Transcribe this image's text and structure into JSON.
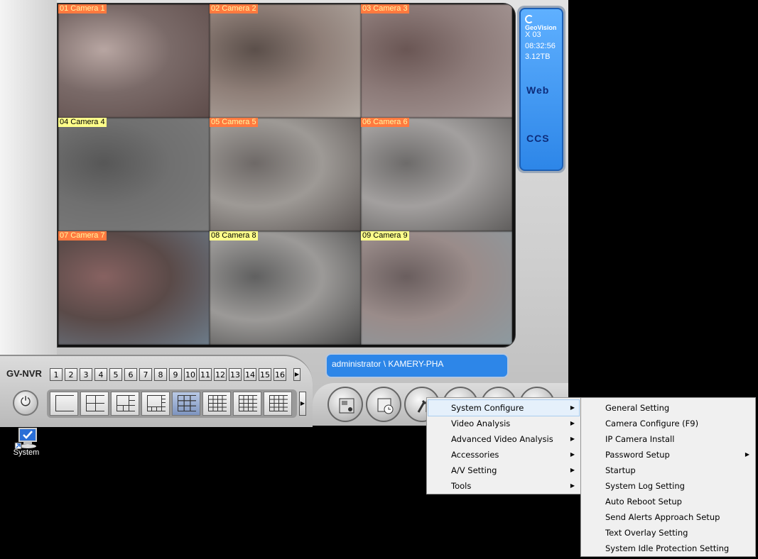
{
  "cameras": [
    {
      "label": "01 Camera 1",
      "status": "recording",
      "feed": [
        "#7a6a68",
        "#b8a6a2",
        "#5e4c4a"
      ]
    },
    {
      "label": "02 Camera 2",
      "status": "recording",
      "feed": [
        "#8f7f78",
        "#5b4f4a",
        "#b3aaa3"
      ]
    },
    {
      "label": "03 Camera 3",
      "status": "recording",
      "feed": [
        "#8c7a78",
        "#6a5654",
        "#a89a98"
      ]
    },
    {
      "label": "04 Camera 4",
      "status": "live",
      "feed": [
        "#707070",
        "#575757",
        "#7c7c7c"
      ]
    },
    {
      "label": "05 Camera 5",
      "status": "recording",
      "feed": [
        "#9e9a96",
        "#6e6967",
        "#5b5553"
      ]
    },
    {
      "label": "06 Camera 6",
      "status": "recording",
      "feed": [
        "#a3a09f",
        "#6d6b6a",
        "#5f5d5c"
      ]
    },
    {
      "label": "07 Camera 7",
      "status": "recording",
      "feed": [
        "#5a4a48",
        "#876261",
        "#6c7b89"
      ]
    },
    {
      "label": "08 Camera 8",
      "status": "live",
      "feed": [
        "#9c9a98",
        "#606060",
        "#4a4a4a"
      ]
    },
    {
      "label": "09 Camera 9",
      "status": "live",
      "feed": [
        "#9a8c8a",
        "#6a5e5e",
        "#8d9aa0"
      ]
    }
  ],
  "side_panel": {
    "brand": "GeoVision",
    "camera_count": "X 03",
    "time": "08:32:56",
    "disk": "3.12TB",
    "web_label": "Web",
    "ccs_label": "CCS"
  },
  "toolbar": {
    "product_label": "GV-NVR",
    "camera_numbers": [
      "1",
      "2",
      "3",
      "4",
      "5",
      "6",
      "7",
      "8",
      "9",
      "10",
      "11",
      "12",
      "13",
      "14",
      "15",
      "16"
    ],
    "user_info": "administrator \\ KAMERY-PHA",
    "layouts": [
      "single-view-icon",
      "quad-view-icon",
      "six-view-icon",
      "eight-view-icon",
      "nine-view-icon",
      "ten-view-icon",
      "thirteen-view-icon",
      "sixteen-view-icon"
    ],
    "active_layout": 4,
    "round_buttons": [
      "exit-monitor-icon",
      "schedule-icon",
      "configure-tools-icon",
      "search-icon",
      "network-icon",
      "pda-icon"
    ]
  },
  "desktop": {
    "system_icon_label": "System"
  },
  "context_menu": {
    "items": [
      {
        "label": "System Configure",
        "submenu": true,
        "highlighted": true
      },
      {
        "label": "Video Analysis",
        "submenu": true
      },
      {
        "label": "Advanced Video Analysis",
        "submenu": true
      },
      {
        "label": "Accessories",
        "submenu": true
      },
      {
        "label": "A/V Setting",
        "submenu": true
      },
      {
        "label": "Tools",
        "submenu": true
      }
    ]
  },
  "submenu": {
    "items": [
      {
        "label": "General Setting"
      },
      {
        "label": "Camera Configure (F9)"
      },
      {
        "label": "IP Camera Install"
      },
      {
        "label": "Password Setup",
        "submenu": true
      },
      {
        "label": "Startup"
      },
      {
        "label": "System Log Setting"
      },
      {
        "label": "Auto Reboot Setup"
      },
      {
        "label": "Send Alerts Approach Setup"
      },
      {
        "label": "Text Overlay Setting"
      },
      {
        "label": "System Idle Protection Setting"
      }
    ]
  },
  "colors": {
    "recording_label_bg": "#ff7a40",
    "live_label_bg": "#ffff8a",
    "panel_blue": "#2d86e8",
    "menu_highlight": "#e5f0fb"
  }
}
